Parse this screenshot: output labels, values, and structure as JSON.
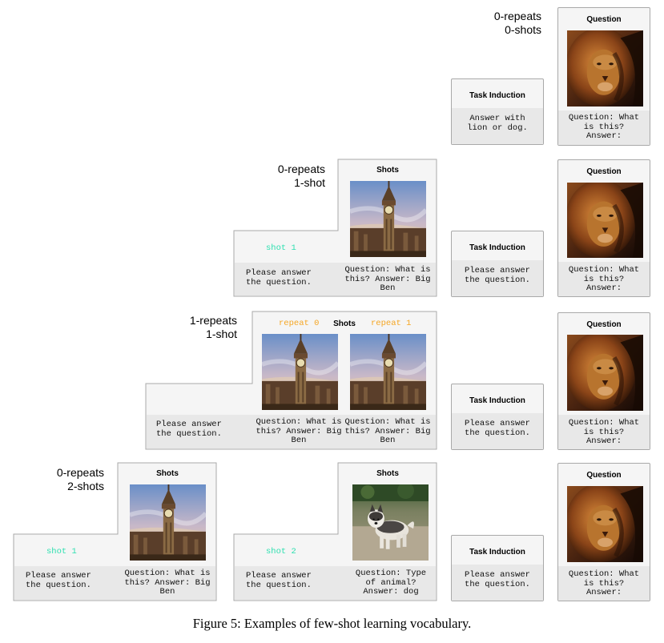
{
  "rows": [
    {
      "label_line1": "0-repeats",
      "label_line2": "0-shots"
    },
    {
      "label_line1": "0-repeats",
      "label_line2": "1-shot"
    },
    {
      "label_line1": "1-repeats",
      "label_line2": "1-shot"
    },
    {
      "label_line1": "0-repeats",
      "label_line2": "2-shots"
    }
  ],
  "titles": {
    "shots": "Shots",
    "task_induction": "Task Induction",
    "question": "Question"
  },
  "tags": {
    "shot_1": "shot 1",
    "shot_2": "shot 2",
    "repeat_0": "repeat 0",
    "repeat_1": "repeat 1"
  },
  "texts": {
    "answer_lion_dog_1": "Answer with",
    "answer_lion_dog_2": "lion or dog.",
    "please_1": "Please answer",
    "please_2": "the question.",
    "bigben_1": "Question: What is",
    "bigben_2": "this? Answer: Big",
    "bigben_3": "Ben",
    "q_what_1": "Question: What",
    "q_what_2": "is this?",
    "q_what_3": "Answer:",
    "dog_1": "Question: Type",
    "dog_2": "of animal?",
    "dog_3": "Answer: dog"
  },
  "caption": "Figure 5: Examples of few-shot learning vocabulary.",
  "colors": {
    "shot_tag": "#2ee0b0",
    "repeat_tag": "#f5a623",
    "box_bg": "#f5f5f5",
    "band_bg": "#e8e8e8"
  }
}
